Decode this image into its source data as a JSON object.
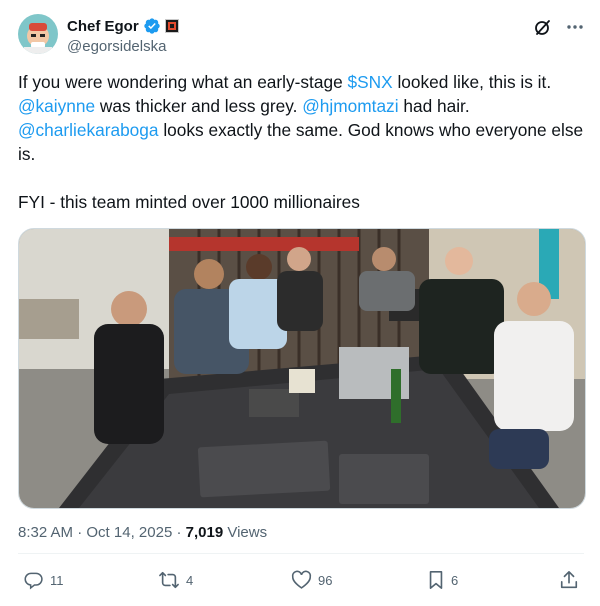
{
  "author": {
    "name": "Chef Egor",
    "handle": "@egorsidelska",
    "verified": true,
    "badge_icon": "affiliate-badge-icon"
  },
  "tweet": {
    "line1_a": "If you were wondering what an early-stage ",
    "ticker": "$SNX",
    "line1_b": " looked like, this is it.",
    "mention1": "@kaiynne",
    "text2": " was thicker and less grey. ",
    "mention2": "@hjmomtazi",
    "text3": " had hair.",
    "mention3": "@charliekaraboga",
    "text4": " looks exactly the same. God knows who everyone else is.",
    "text5": "FYI - this team minted over 1000 millionaires"
  },
  "meta": {
    "time": "8:32 AM",
    "sep1": " · ",
    "date": "Oct 14, 2025",
    "sep2": " · ",
    "views_count": "7,019",
    "views_label": " Views"
  },
  "actions": {
    "replies": "11",
    "reposts": "4",
    "likes": "96",
    "bookmarks": "6"
  },
  "colors": {
    "link": "#1d9bf0",
    "secondary_text": "#536471",
    "verified": "#1d9bf0"
  }
}
